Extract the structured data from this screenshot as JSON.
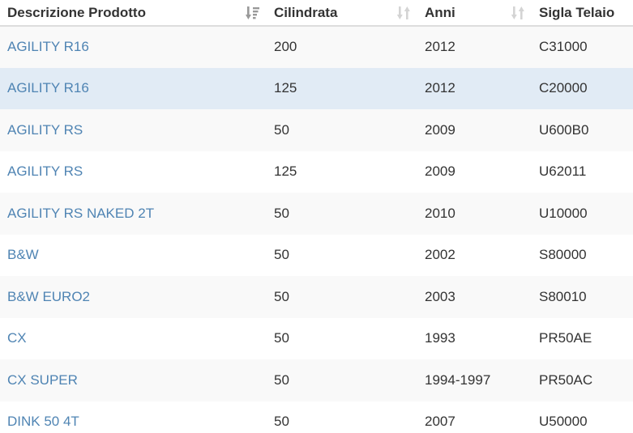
{
  "table": {
    "headers": [
      {
        "label": "Descrizione Prodotto",
        "sort": "descending-active"
      },
      {
        "label": "Cilindrata",
        "sort": "both"
      },
      {
        "label": "Anni",
        "sort": "both"
      },
      {
        "label": "Sigla Telaio",
        "sort": "none"
      }
    ],
    "rows": [
      {
        "descrizione": "AGILITY R16",
        "cilindrata": "200",
        "anni": "2012",
        "sigla": "C31000",
        "selected": false
      },
      {
        "descrizione": "AGILITY R16",
        "cilindrata": "125",
        "anni": "2012",
        "sigla": "C20000",
        "selected": true
      },
      {
        "descrizione": "AGILITY RS",
        "cilindrata": "50",
        "anni": "2009",
        "sigla": "U600B0",
        "selected": false
      },
      {
        "descrizione": "AGILITY RS",
        "cilindrata": "125",
        "anni": "2009",
        "sigla": "U62011",
        "selected": false
      },
      {
        "descrizione": "AGILITY RS NAKED 2T",
        "cilindrata": "50",
        "anni": "2010",
        "sigla": "U10000",
        "selected": false
      },
      {
        "descrizione": "B&W",
        "cilindrata": "50",
        "anni": "2002",
        "sigla": "S80000",
        "selected": false
      },
      {
        "descrizione": "B&W EURO2",
        "cilindrata": "50",
        "anni": "2003",
        "sigla": "S80010",
        "selected": false
      },
      {
        "descrizione": "CX",
        "cilindrata": "50",
        "anni": "1993",
        "sigla": "PR50AE",
        "selected": false
      },
      {
        "descrizione": "CX SUPER",
        "cilindrata": "50",
        "anni": "1994-1997",
        "sigla": "PR50AC",
        "selected": false
      },
      {
        "descrizione": "DINK 50 4T",
        "cilindrata": "50",
        "anni": "2007",
        "sigla": "U50000",
        "selected": false
      }
    ]
  },
  "colors": {
    "link": "#4f84b3",
    "row_stripe": "#f9f9f9",
    "row_selected": "#e1ebf5",
    "sort_icon_active": "#999999",
    "sort_icon_inactive": "#d4d4d4"
  },
  "icons": {
    "sort_desc": "sort-amount-desc-icon",
    "sort_both": "sort-both-icon"
  }
}
